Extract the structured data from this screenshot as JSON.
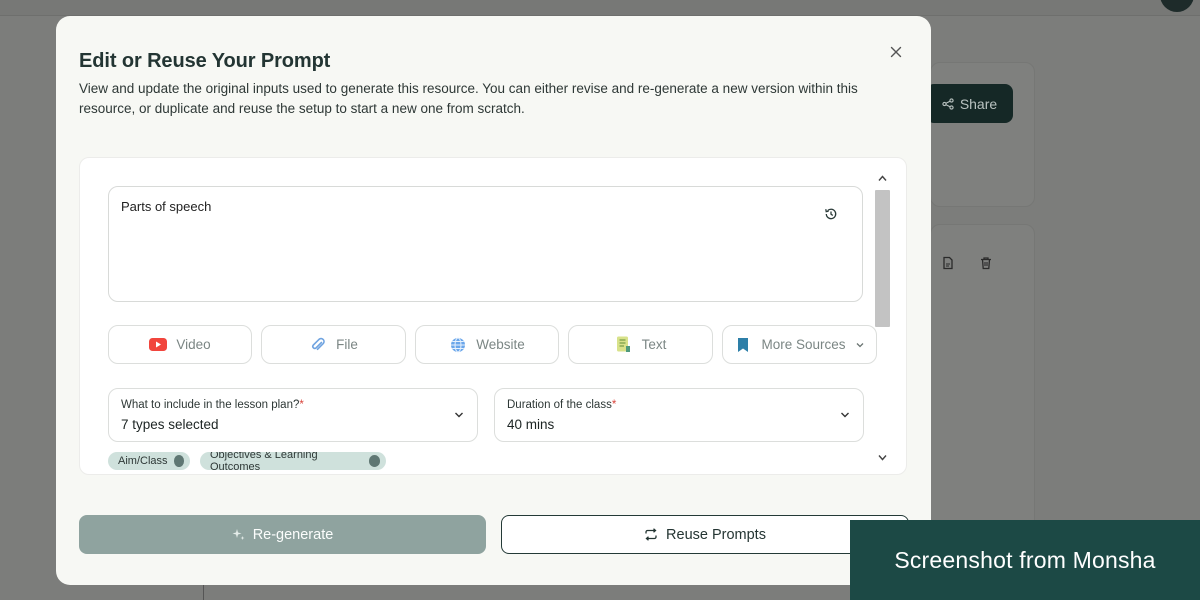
{
  "background": {
    "share_label": "Share"
  },
  "modal": {
    "title": "Edit or Reuse Your Prompt",
    "description": "View and update the original inputs used to generate this resource. You can either revise and re-generate a new version within this resource, or duplicate and reuse the setup to start a new one from scratch.",
    "prompt_text": "Parts of speech",
    "sources": [
      {
        "label": "Video",
        "icon": "video-icon"
      },
      {
        "label": "File",
        "icon": "paperclip-icon"
      },
      {
        "label": "Website",
        "icon": "globe-icon"
      },
      {
        "label": "Text",
        "icon": "text-doc-icon"
      },
      {
        "label": "More Sources",
        "icon": "bookmark-icon"
      }
    ],
    "lesson_plan_select": {
      "label": "What to include in the lesson plan?",
      "required_mark": "*",
      "value": "7 types selected"
    },
    "duration_select": {
      "label": "Duration of the class",
      "required_mark": "*",
      "value": "40 mins"
    },
    "chips": [
      "Aim/Class",
      "Objectives & Learning Outcomes"
    ],
    "regenerate_label": "Re-generate",
    "reuse_label": "Reuse Prompts"
  },
  "watermark": "Screenshot from Monsha",
  "colors": {
    "primary_dark": "#1c4945",
    "regen_button": "#8fa39f",
    "required": "#d9453c",
    "modal_bg": "#f7f8f4"
  }
}
